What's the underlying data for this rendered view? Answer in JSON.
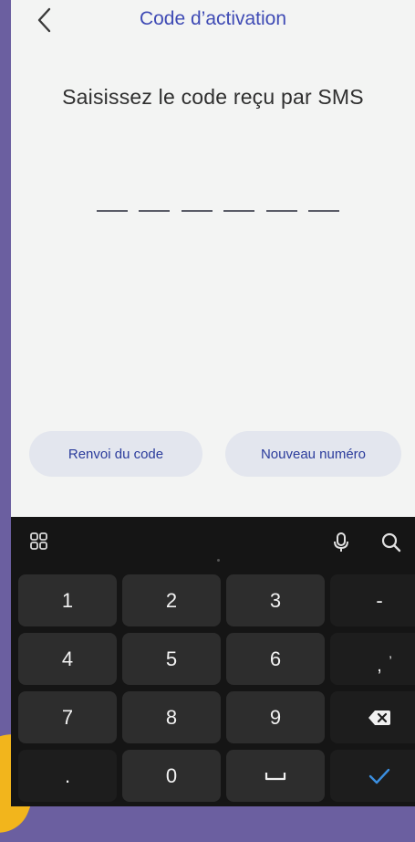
{
  "header": {
    "title": "Code d’activation",
    "back_icon": "chevron-left-icon"
  },
  "instruction": "Saisissez le code reçu par SMS",
  "code": {
    "length": 6,
    "value": ""
  },
  "actions": {
    "resend_label": "Renvoi du code",
    "new_number_label": "Nouveau numéro"
  },
  "keyboard": {
    "toolbar": {
      "grid_icon": "grid-icon",
      "mic_icon": "microphone-icon",
      "search_icon": "search-icon"
    },
    "keys": {
      "k1": "1",
      "k2": "2",
      "k3": "3",
      "minus": "-",
      "k4": "4",
      "k5": "5",
      "k6": "6",
      "comma_top": ",",
      "comma_bottom": ",",
      "k7": "7",
      "k8": "8",
      "k9": "9",
      "dot": ".",
      "k0": "0"
    },
    "icons": {
      "backspace": "backspace-icon",
      "space": "space-icon",
      "enter": "checkmark-icon"
    }
  },
  "colors": {
    "title": "#3f4bb5",
    "button_bg": "#e3e6ee",
    "button_text": "#2b3c9c",
    "keyboard_bg": "#151515",
    "enter": "#3b8fe0"
  }
}
